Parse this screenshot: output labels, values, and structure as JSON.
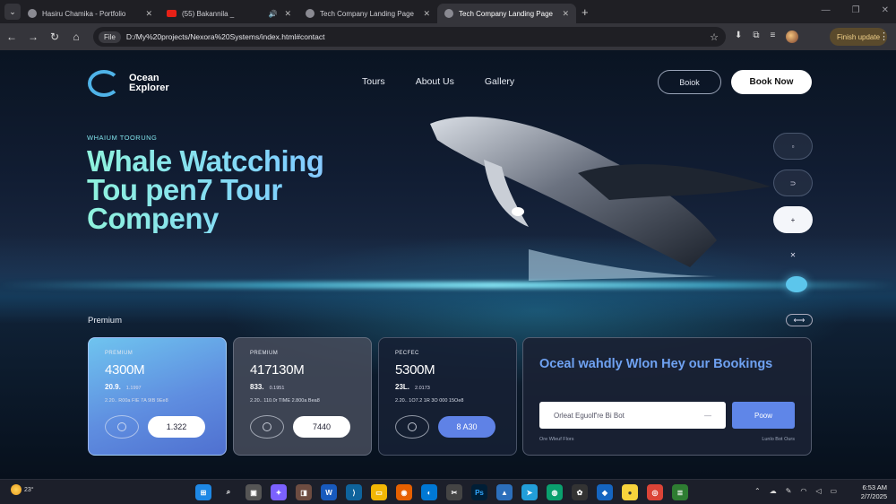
{
  "browser": {
    "tabs": [
      {
        "title": "Hasiru Chamika - Portfolio",
        "active": false,
        "favicon": "globe-icon"
      },
      {
        "title": "(55) Bakannila _ ",
        "active": false,
        "favicon": "youtube-icon",
        "audio": true
      },
      {
        "title": "Tech Company Landing Page",
        "active": false,
        "favicon": "globe-icon"
      },
      {
        "title": "Tech Company Landing Page",
        "active": true,
        "favicon": "globe-icon"
      }
    ],
    "file_chip": "File",
    "url": "D:/My%20projects/Nexora%20Systems/index.html#contact",
    "finish_update": "Finish update"
  },
  "site": {
    "logo_line1": "Ocean",
    "logo_line2": "Explorer",
    "nav": [
      "Tours",
      "About Us",
      "Gallery"
    ],
    "btn_outline": "Boiok",
    "btn_book": "Book Now",
    "eyebrow": "WHAIUM TOORUNG",
    "hero_lines": [
      "Whale Watcching",
      "Tou pen7 Tour",
      "Compeny"
    ],
    "section_label": "Premium",
    "cards": [
      {
        "tag": "PREMIUM",
        "price": "4300M",
        "sub": "20.9.",
        "sub_small": "1.1997",
        "meta": "2.20.. R00a  FIE 7A 9IB 9Ee8",
        "pill": "1.322"
      },
      {
        "tag": "PREMIUM",
        "price": "417130M",
        "sub": "833.",
        "sub_small": "0.1951",
        "meta": "2.20.. 110.0r  TIME 2.800a Bea8",
        "pill": "7440"
      },
      {
        "tag": "PECFEC",
        "price": "5300M",
        "sub": "23L.",
        "sub_small": "2.0173",
        "meta": "2.20.. 1O7.2  1R 3O 000 15Oe8",
        "pill": "8 A30"
      }
    ],
    "booking": {
      "title": "Oceal wahdly Wlon Hey our Bookings",
      "input_placeholder": "Orleat Eguolf're Bi Bot",
      "button": "Poow",
      "foot_left": "Ore Wleuf Flors",
      "foot_right": "Lunlo Bot Ours"
    }
  },
  "taskbar": {
    "weather": "23°",
    "time": "6:53 AM",
    "date": "2/7/2025"
  },
  "colors": {
    "accent": "#5f86e8",
    "hero_gradient_start": "#8ff3dd",
    "hero_gradient_end": "#a5b8ff",
    "card1": "#6fc4ef"
  }
}
